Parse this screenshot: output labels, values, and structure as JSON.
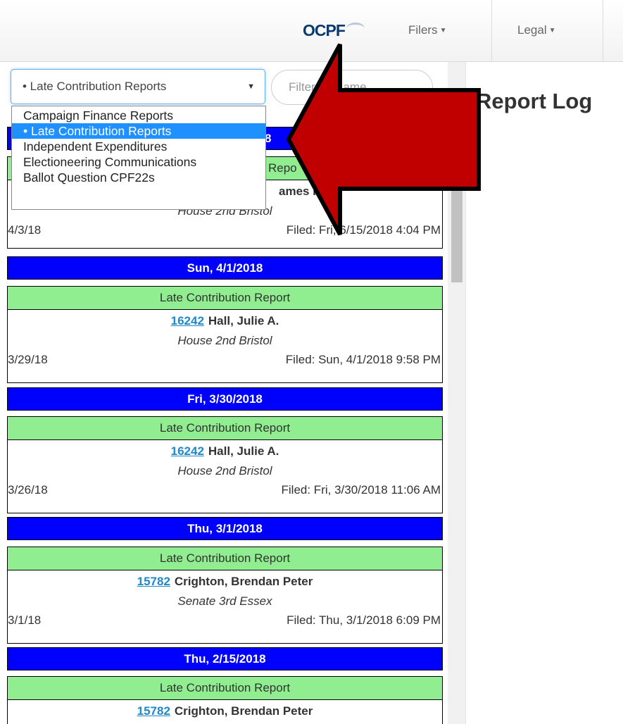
{
  "navbar": {
    "logo": "OCPF",
    "items": [
      {
        "label": "Filers"
      },
      {
        "label": "Legal"
      }
    ]
  },
  "filter": {
    "selected": "• Late Contribution Reports",
    "placeholder": "Filter by Name",
    "options": [
      "Campaign Finance Reports",
      "• Late Contribution Reports",
      "Independent Expenditures",
      "Electioneering Communications",
      "Ballot Question CPF22s"
    ]
  },
  "page_title": "Report Log",
  "first_group": {
    "date_fragment": "8",
    "type_fragment": "Repo",
    "name_fragment": "ames P",
    "office": "House 2nd Bristol",
    "period_date": "4/3/18",
    "filed": "Filed: Fri, 6/15/2018 4:04 PM"
  },
  "groups": [
    {
      "date": "Sun, 4/1/2018",
      "type": "Late Contribution Report",
      "cpf_id": "16242",
      "name": "Hall, Julie A.",
      "office": "House 2nd Bristol",
      "period_date": "3/29/18",
      "filed": "Filed: Sun, 4/1/2018 9:58 PM"
    },
    {
      "date": "Fri, 3/30/2018",
      "type": "Late Contribution Report",
      "cpf_id": "16242",
      "name": "Hall, Julie A.",
      "office": "House 2nd Bristol",
      "period_date": "3/26/18",
      "filed": "Filed: Fri, 3/30/2018 11:06 AM"
    },
    {
      "date": "Thu, 3/1/2018",
      "type": "Late Contribution Report",
      "cpf_id": "15782",
      "name": "Crighton, Brendan Peter",
      "office": "Senate 3rd Essex",
      "period_date": "3/1/18",
      "filed": "Filed: Thu, 3/1/2018 6:09 PM"
    },
    {
      "date": "Thu, 2/15/2018",
      "type": "Late Contribution Report",
      "cpf_id": "15782",
      "name": "Crighton, Brendan Peter"
    }
  ],
  "colors": {
    "date_bar": "#0000ff",
    "report_type": "#90ee90",
    "link": "#1e88c8",
    "arrow": "#c00000",
    "selected_option": "#1e90ff"
  }
}
